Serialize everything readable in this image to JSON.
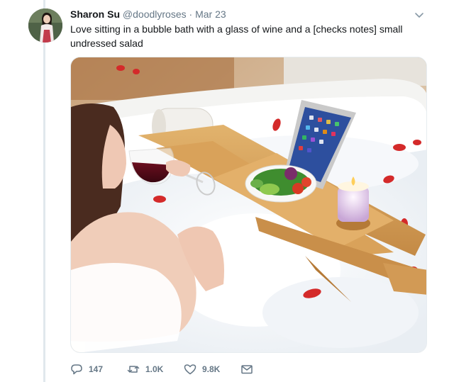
{
  "tweet": {
    "author_name": "Sharon Su",
    "handle": "@doodlyroses",
    "separator": "·",
    "date": "Mar 23",
    "text": "Love sitting in a bubble bath with a glass of wine and a [checks notes] small undressed salad"
  },
  "actions": {
    "replies": "147",
    "retweets": "1.0K",
    "likes": "9.8K"
  },
  "icons": {
    "reply": "reply-icon",
    "retweet": "retweet-icon",
    "like": "heart-icon",
    "dm": "envelope-icon",
    "menu": "chevron-down-icon"
  },
  "colors": {
    "text": "#14171a",
    "secondary": "#657786",
    "border": "#e1e8ed"
  }
}
